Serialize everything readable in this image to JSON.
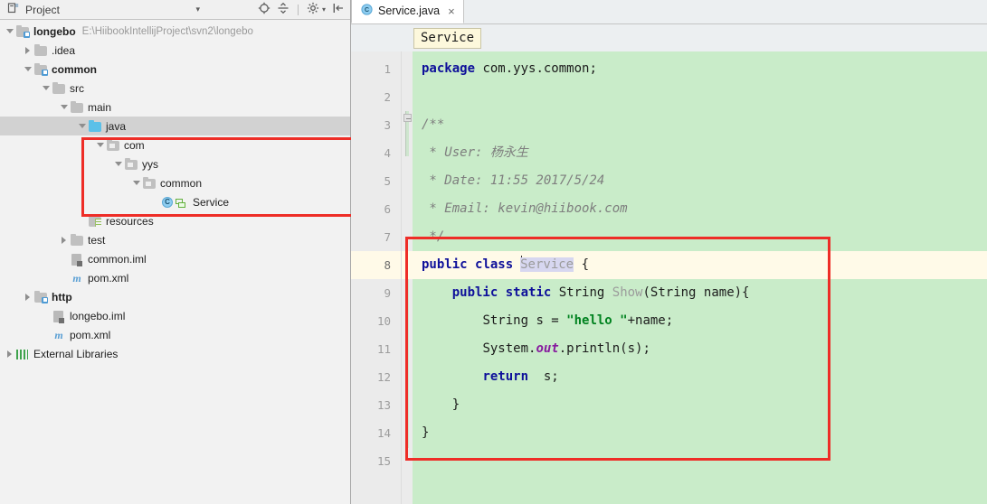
{
  "project_panel": {
    "title": "Project",
    "header_icons": [
      {
        "name": "project-view-selector-dropdown",
        "glyph": "▾"
      },
      {
        "name": "locate-in-tree-icon",
        "glyph": "⊕"
      },
      {
        "name": "collapse-all-icon",
        "glyph": "≒"
      },
      {
        "name": "settings-gear-icon",
        "glyph": "⚙"
      },
      {
        "name": "hide-panel-icon",
        "glyph": "⇥"
      }
    ],
    "tree": [
      {
        "label": "longebo",
        "sub": "E:\\HiibookIntellijProject\\svn2\\longebo",
        "indent": 0,
        "twisty": "down",
        "icon": "module-folder",
        "bold": true,
        "selected": false
      },
      {
        "label": ".idea",
        "sub": "",
        "indent": 1,
        "twisty": "right",
        "icon": "folder",
        "bold": false,
        "selected": false
      },
      {
        "label": "common",
        "sub": "",
        "indent": 1,
        "twisty": "down",
        "icon": "module-folder",
        "bold": true,
        "selected": false
      },
      {
        "label": "src",
        "sub": "",
        "indent": 2,
        "twisty": "down",
        "icon": "folder",
        "bold": false,
        "selected": false
      },
      {
        "label": "main",
        "sub": "",
        "indent": 3,
        "twisty": "down",
        "icon": "folder",
        "bold": false,
        "selected": false
      },
      {
        "label": "java",
        "sub": "",
        "indent": 4,
        "twisty": "down",
        "icon": "source-folder",
        "bold": false,
        "selected": true
      },
      {
        "label": "com",
        "sub": "",
        "indent": 5,
        "twisty": "down",
        "icon": "package",
        "bold": false,
        "selected": false
      },
      {
        "label": "yys",
        "sub": "",
        "indent": 6,
        "twisty": "down",
        "icon": "package",
        "bold": false,
        "selected": false
      },
      {
        "label": "common",
        "sub": "",
        "indent": 7,
        "twisty": "down",
        "icon": "package",
        "bold": false,
        "selected": false
      },
      {
        "label": "Service",
        "sub": "",
        "indent": 8,
        "twisty": "none",
        "icon": "java-class",
        "bold": false,
        "selected": false
      },
      {
        "label": "resources",
        "sub": "",
        "indent": 4,
        "twisty": "none",
        "icon": "resources-folder",
        "bold": false,
        "selected": false
      },
      {
        "label": "test",
        "sub": "",
        "indent": 3,
        "twisty": "right",
        "icon": "folder",
        "bold": false,
        "selected": false
      },
      {
        "label": "common.iml",
        "sub": "",
        "indent": 3,
        "twisty": "none",
        "icon": "iml-file",
        "bold": false,
        "selected": false
      },
      {
        "label": "pom.xml",
        "sub": "",
        "indent": 3,
        "twisty": "none",
        "icon": "maven-file",
        "bold": false,
        "selected": false
      },
      {
        "label": "http",
        "sub": "",
        "indent": 1,
        "twisty": "right",
        "icon": "module-folder",
        "bold": true,
        "selected": false
      },
      {
        "label": "longebo.iml",
        "sub": "",
        "indent": 2,
        "twisty": "none",
        "icon": "iml-file",
        "bold": false,
        "selected": false
      },
      {
        "label": "pom.xml",
        "sub": "",
        "indent": 2,
        "twisty": "none",
        "icon": "maven-file",
        "bold": false,
        "selected": false
      },
      {
        "label": "External Libraries",
        "sub": "",
        "indent": 0,
        "twisty": "right",
        "icon": "libraries",
        "bold": false,
        "selected": false
      }
    ]
  },
  "editor": {
    "tab": {
      "label": "Service.java",
      "close_glyph": "×",
      "icon": "java-class-icon"
    },
    "breadcrumb": "Service",
    "line_numbers": [
      "1",
      "2",
      "3",
      "4",
      "5",
      "6",
      "7",
      "8",
      "9",
      "10",
      "11",
      "12",
      "13",
      "14",
      "15"
    ],
    "active_line": 8,
    "lines": [
      {
        "n": 1,
        "text": "package com.yys.common;"
      },
      {
        "n": 2,
        "text": ""
      },
      {
        "n": 3,
        "text": "/**"
      },
      {
        "n": 4,
        "text": " * User: 杨永生"
      },
      {
        "n": 5,
        "text": " * Date: 11:55 2017/5/24"
      },
      {
        "n": 6,
        "text": " * Email: kevin@hiibook.com"
      },
      {
        "n": 7,
        "text": " */"
      },
      {
        "n": 8,
        "text": "public class Service {"
      },
      {
        "n": 9,
        "text": "    public static String Show(String name){"
      },
      {
        "n": 10,
        "text": "        String s = \"hello \"+name;"
      },
      {
        "n": 11,
        "text": "        System.out.println(s);"
      },
      {
        "n": 12,
        "text": "        return  s;"
      },
      {
        "n": 13,
        "text": "    }"
      },
      {
        "n": 14,
        "text": "}"
      },
      {
        "n": 15,
        "text": ""
      }
    ],
    "tokens": {
      "kw_package": "package",
      "pkg_name": " com.yys.common;",
      "cmt_open": "/**",
      "cmt_user": " * User: 杨永生",
      "cmt_date": " * Date: 11:55 2017/5/24",
      "cmt_email": " * Email: kevin@hiibook.com",
      "cmt_close": " */",
      "kw_public": "public",
      "kw_class": "class",
      "class_name": "Service",
      "brace_open": "{",
      "kw_public2": "public",
      "kw_static": "static",
      "type_string": "String",
      "method_name": "Show",
      "method_params": "(String name){",
      "decl_string": "String s = ",
      "str_hello": "\"hello \"",
      "decl_tail": "+name;",
      "sysout_pre": "System.",
      "sysout_field": "out",
      "sysout_post": ".println(s);",
      "kw_return": "return",
      "return_val": "s;",
      "brace_close_inner": "}",
      "brace_close_outer": "}"
    }
  },
  "annotations": {
    "tree_highlight": {
      "name": "package-path-highlight-box",
      "color": "#ee2d27"
    },
    "code_highlight": {
      "name": "class-body-highlight-box",
      "color": "#ee2d27"
    }
  },
  "colors": {
    "added_line_background": "#c9ecc9",
    "caret_line_background": "#fffae8",
    "keyword": "#0e109a",
    "string": "#00821f",
    "comment": "#7e7e7e",
    "field": "#871b9e",
    "annotation_red": "#ee2d27",
    "selection_gray": "#d2d2d2"
  }
}
